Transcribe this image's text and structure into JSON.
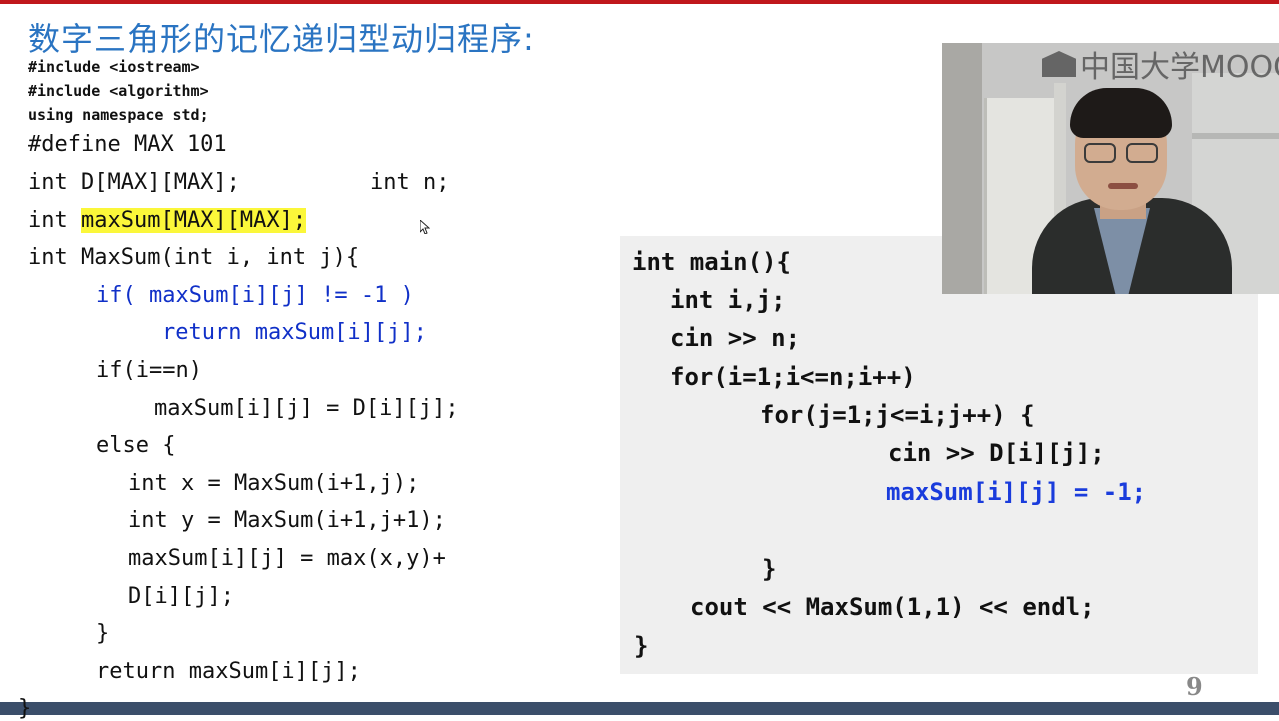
{
  "slide": {
    "title": "数字三角形的记忆递归型动归程序:",
    "includes": [
      "#include <iostream>",
      "#include <algorithm>",
      "using namespace std;"
    ],
    "left_code": {
      "define": "#define MAX 101",
      "decl_d": "int D[MAX][MAX];",
      "decl_n": "int n;",
      "decl_max_type": "int ",
      "decl_max_name": "maxSum[MAX][MAX];",
      "func_sig": "int MaxSum(int i, int j){",
      "if_memo": "if( maxSum[i][j] != -1 )",
      "return_memo": "return maxSum[i][j];",
      "if_base": "if(i==n)",
      "base_assign": "maxSum[i][j] = D[i][j];",
      "else": "else {",
      "x_decl": "int x = MaxSum(i+1,j);",
      "y_decl": "int y = MaxSum(i+1,j+1);",
      "max_assign": "maxSum[i][j] = max(x,y)+",
      "max_assign_cont": "D[i][j];",
      "close_else": "}",
      "return_final": "return maxSum[i][j];",
      "close_func": "}"
    },
    "right_code": {
      "main_sig": "int main(){",
      "ij_decl": "int i,j;",
      "cin_n": "cin >> n;",
      "for_i": "for(i=1;i<=n;i++)",
      "for_j": "for(j=1;j<=i;j++) {",
      "cin_d": "cin >> D[i][j];",
      "init_memo": "maxSum[i][j] = -1;",
      "close_for": "}",
      "cout": "cout << MaxSum(1,1) << endl;",
      "close_main": "}"
    },
    "page_number": "9"
  },
  "video": {
    "logo_text": "中国大学MOOC"
  },
  "colors": {
    "title": "#2a74c2",
    "code_blue": "#1030c8",
    "highlight": "#fbf73a",
    "panel_bg": "#efefef",
    "top_rule": "#c0171c",
    "bottom_bar": "#3b4e6a"
  },
  "icons": [
    "cursor-arrow-icon",
    "mooc-logo-icon"
  ]
}
